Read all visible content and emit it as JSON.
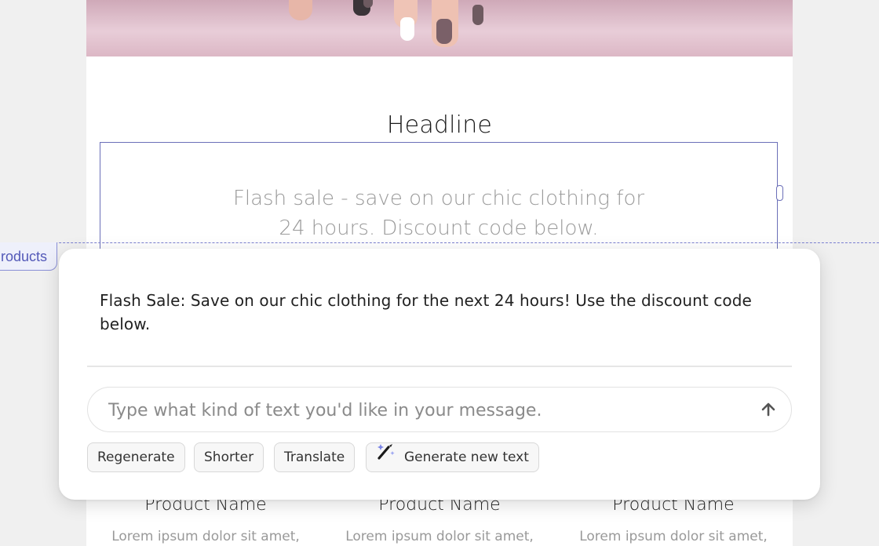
{
  "section_tag": "roducts",
  "headline": "Headline",
  "body_text": "Flash sale - save on our chic clothing for 24 hours. Discount code below.",
  "ai_panel": {
    "suggestion": "Flash Sale: Save on our chic clothing for the next 24 hours! Use the discount code below.",
    "prompt_placeholder": "Type what kind of text you'd like in your message.",
    "prompt_value": "",
    "actions": {
      "regenerate": "Regenerate",
      "shorter": "Shorter",
      "translate": "Translate",
      "generate_new": "Generate new text"
    }
  },
  "products": [
    {
      "name": "Product Name",
      "desc": "Lorem ipsum dolor sit amet,"
    },
    {
      "name": "Product Name",
      "desc": "Lorem ipsum dolor sit amet,"
    },
    {
      "name": "Product Name",
      "desc": "Lorem ipsum dolor sit amet,"
    }
  ],
  "colors": {
    "selection": "#6b6fb8",
    "page_bg": "#f0f0f0"
  },
  "icons": [
    "send-arrow-icon",
    "magic-wand-icon"
  ]
}
